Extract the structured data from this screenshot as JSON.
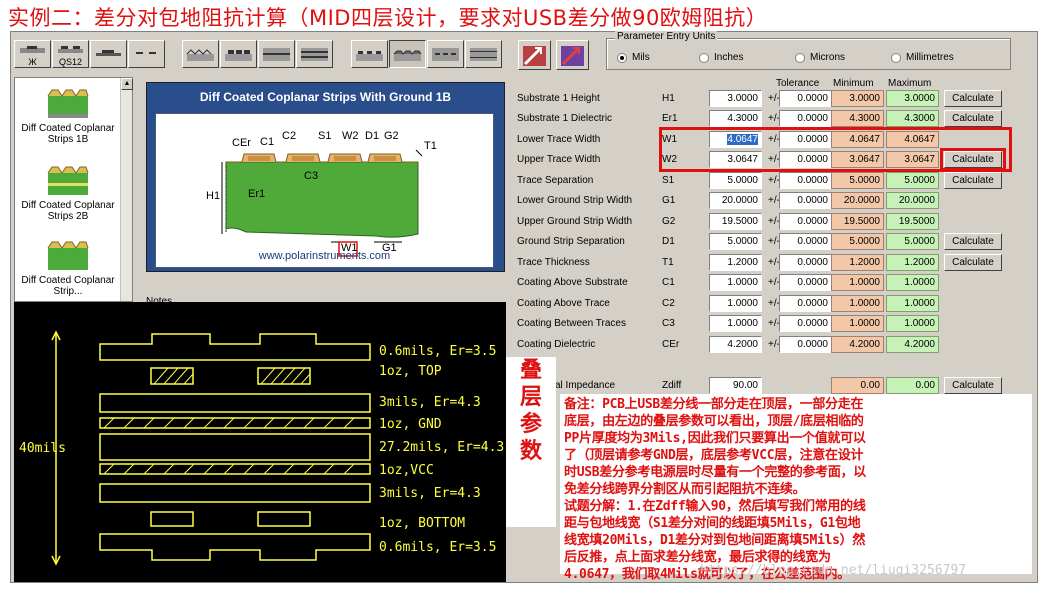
{
  "headline": "实例二：差分对包地阻抗计算（MID四层设计，要求对USB差分做90欧姆阻抗）",
  "toolbar": {
    "btn1_label": "Ж",
    "btn2_label": "QS12"
  },
  "units": {
    "title": "Parameter Entry Units",
    "options": [
      "Mils",
      "Inches",
      "Microns",
      "Millimetres"
    ],
    "selected": "Mils"
  },
  "models": [
    {
      "label": "Diff Coated Coplanar Strips 1B"
    },
    {
      "label": "Diff Coated Coplanar Strips 2B"
    },
    {
      "label": "Diff Coated Coplanar Strip..."
    }
  ],
  "diagram": {
    "title": "Diff Coated Coplanar Strips With Ground  1B",
    "url": "www.polarinstruments.com",
    "labels": {
      "CEr": "CEr",
      "C1": "C1",
      "C2": "C2",
      "S1": "S1",
      "W2": "W2",
      "D1": "D1",
      "G2": "G2",
      "T1": "T1",
      "H1": "H1",
      "Er1": "Er1",
      "C3": "C3",
      "W1": "W1",
      "G1": "G1"
    }
  },
  "notes_label": "Notes",
  "table": {
    "headers": {
      "tolerance": "Tolerance",
      "minimum": "Minimum",
      "maximum": "Maximum"
    },
    "rows": [
      {
        "name": "Substrate 1 Height",
        "sym": "H1",
        "val": "3.0000",
        "tol": "0.0000",
        "min": "3.0000",
        "max": "3.0000",
        "calc": "Calculate"
      },
      {
        "name": "Substrate 1 Dielectric",
        "sym": "Er1",
        "val": "4.3000",
        "tol": "0.0000",
        "min": "4.3000",
        "max": "4.3000",
        "calc": "Calculate"
      },
      {
        "name": "Lower Trace Width",
        "sym": "W1",
        "val": "4.0647",
        "tol": "0.0000",
        "min": "4.0647",
        "max": "4.0647",
        "calc": ""
      },
      {
        "name": "Upper Trace Width",
        "sym": "W2",
        "val": "3.0647",
        "tol": "0.0000",
        "min": "3.0647",
        "max": "3.0647",
        "calc": "Calculate"
      },
      {
        "name": "Trace Separation",
        "sym": "S1",
        "val": "5.0000",
        "tol": "0.0000",
        "min": "5.0000",
        "max": "5.0000",
        "calc": "Calculate"
      },
      {
        "name": "Lower Ground Strip Width",
        "sym": "G1",
        "val": "20.0000",
        "tol": "0.0000",
        "min": "20.0000",
        "max": "20.0000",
        "calc": ""
      },
      {
        "name": "Upper Ground Strip Width",
        "sym": "G2",
        "val": "19.5000",
        "tol": "0.0000",
        "min": "19.5000",
        "max": "19.5000",
        "calc": ""
      },
      {
        "name": "Ground Strip Separation",
        "sym": "D1",
        "val": "5.0000",
        "tol": "0.0000",
        "min": "5.0000",
        "max": "5.0000",
        "calc": "Calculate"
      },
      {
        "name": "Trace Thickness",
        "sym": "T1",
        "val": "1.2000",
        "tol": "0.0000",
        "min": "1.2000",
        "max": "1.2000",
        "calc": "Calculate"
      },
      {
        "name": "Coating Above Substrate",
        "sym": "C1",
        "val": "1.0000",
        "tol": "0.0000",
        "min": "1.0000",
        "max": "1.0000",
        "calc": ""
      },
      {
        "name": "Coating Above Trace",
        "sym": "C2",
        "val": "1.0000",
        "tol": "0.0000",
        "min": "1.0000",
        "max": "1.0000",
        "calc": ""
      },
      {
        "name": "Coating Between Traces",
        "sym": "C3",
        "val": "1.0000",
        "tol": "0.0000",
        "min": "1.0000",
        "max": "1.0000",
        "calc": ""
      },
      {
        "name": "Coating Dielectric",
        "sym": "CEr",
        "val": "4.2000",
        "tol": "0.0000",
        "min": "4.2000",
        "max": "4.2000",
        "calc": ""
      }
    ],
    "impedance": {
      "name": "al Impedance",
      "sym": "Zdiff",
      "val": "90.00",
      "min": "0.00",
      "max": "0.00",
      "calc": "Calculate"
    }
  },
  "stackup": {
    "thickness": "40mils",
    "layers": [
      "0.6mils, Er=3.5",
      "1oz, TOP",
      "3mils, Er=4.3",
      "1oz, GND",
      "27.2mils, Er=4.3",
      "1oz,VCC",
      "3mils, Er=4.3",
      "1oz, BOTTOM",
      "0.6mils, Er=3.5"
    ]
  },
  "stack_label": [
    "叠",
    "层",
    "参",
    "数"
  ],
  "note_lines": [
    "备注：PCB上USB差分线一部分走在顶层，一部分走在",
    "底层，由左边的叠层参数可以看出，顶层/底层相临的",
    "PP片厚度均为3Mils,因此我们只要算出一个值就可以",
    "了（顶层请参考GND层，底层参考VCC层，注意在设计",
    "时USB差分参考电源层时尽量有一个完整的参考面，以",
    "免差分线跨界分割区从而引起阻抗不连续。",
    "试题分解：1.在Zdff输入90，然后填写我们常用的线",
    "距与包地线宽（S1差分对间的线距填5Mils，G1包地",
    "线宽填20Mils，D1差分对到包地间距离填5Mils）然",
    "后反推，点上面求差分线宽，最后求得的线宽为",
    "4.0647，我们取4Mils就可以了，在公差范围内。"
  ],
  "watermark": "https://blog.csdn.net/liuqi3256797",
  "colors": {
    "accent_red": "#e01010",
    "min_fill": "#f3c8a8",
    "max_fill": "#c6f2b8",
    "stack_yellow": "#ffff40"
  }
}
